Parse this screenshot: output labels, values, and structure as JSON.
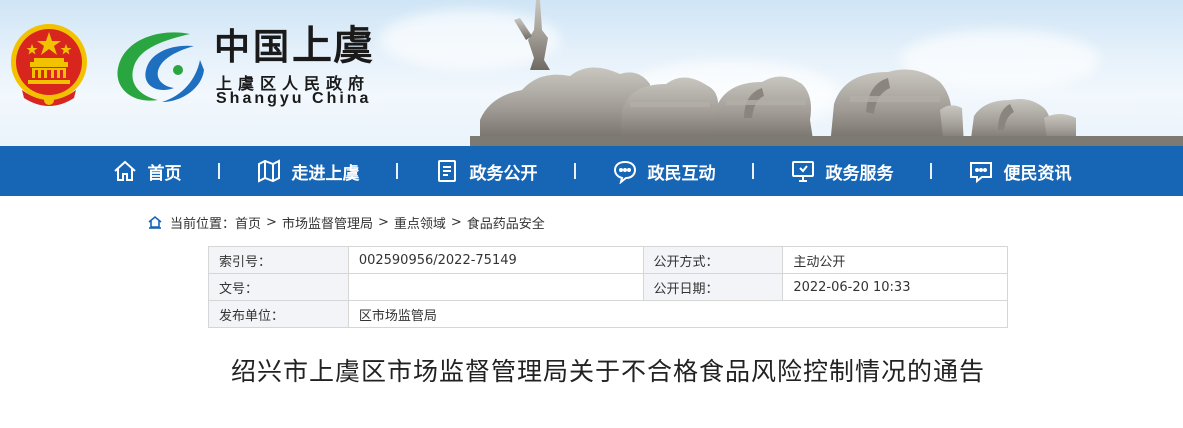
{
  "header": {
    "title_part1": "中国",
    "title_part2": "上虞",
    "subtitle": "上虞区人民政府",
    "title_en": "Shangyu China"
  },
  "nav": {
    "items": [
      {
        "label": "首页",
        "icon": "home-icon"
      },
      {
        "label": "走进上虞",
        "icon": "map-icon"
      },
      {
        "label": "政务公开",
        "icon": "document-icon"
      },
      {
        "label": "政民互动",
        "icon": "chat-icon"
      },
      {
        "label": "政务服务",
        "icon": "monitor-icon"
      },
      {
        "label": "便民资讯",
        "icon": "message-icon"
      }
    ]
  },
  "breadcrumb": {
    "prefix": "当前位置：",
    "items": [
      "首页",
      "市场监督管理局",
      "重点领域",
      "食品药品安全"
    ],
    "separator": ">"
  },
  "info": {
    "index_label": "索引号：",
    "index_value": "002590956/2022-75149",
    "method_label": "公开方式：",
    "method_value": "主动公开",
    "doc_label": "文号：",
    "doc_value": "",
    "date_label": "公开日期：",
    "date_value": "2022-06-20 10:33",
    "publisher_label": "发布单位：",
    "publisher_value": "区市场监管局"
  },
  "article": {
    "title": "绍兴市上虞区市场监督管理局关于不合格食品风险控制情况的通告"
  },
  "colors": {
    "nav_bg": "#1766b6",
    "emblem_red": "#d8261f",
    "emblem_gold": "#f2c200",
    "logo_green": "#2aa640",
    "logo_blue": "#1e6fc0"
  }
}
